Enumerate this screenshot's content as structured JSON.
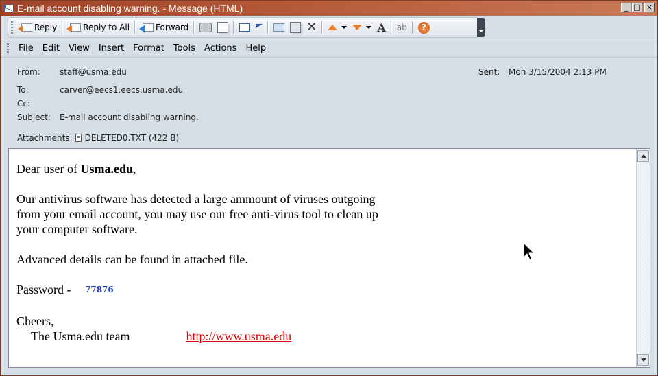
{
  "window": {
    "title": "E-mail account disabling warning. - Message (HTML)",
    "controls": {
      "minimize": "_",
      "maximize": "□",
      "close": "×"
    }
  },
  "toolbar": {
    "reply_label": "Reply",
    "reply_all_label": "Reply to All",
    "forward_label": "Forward",
    "icons": [
      "reply-icon",
      "reply-all-icon",
      "forward-icon",
      "print-icon",
      "copy-icon",
      "move-to-folder-icon",
      "flag-icon",
      "file-icon",
      "delete-icon",
      "previous-item-icon",
      "next-item-icon",
      "font-size-icon",
      "translate-icon",
      "help-icon"
    ]
  },
  "menu": {
    "items": [
      "File",
      "Edit",
      "View",
      "Insert",
      "Format",
      "Tools",
      "Actions",
      "Help"
    ]
  },
  "headers": {
    "from_label": "From:",
    "from_value": "staff@usma.edu",
    "sent_label": "Sent:",
    "sent_value": "Mon 3/15/2004 2:13 PM",
    "to_label": "To:",
    "to_value": "carver@eecs1.eecs.usma.edu",
    "cc_label": "Cc:",
    "cc_value": "",
    "subject_label": "Subject:",
    "subject_value": "E-mail account disabling warning.",
    "attachments_label": "Attachments:",
    "attachment_name": "DELETED0.TXT (422 B)"
  },
  "message": {
    "greeting_prefix": "Dear user of ",
    "greeting_domain": "Usma.edu",
    "greeting_suffix": ",",
    "para1_line1": "Our antivirus software has detected a large ammount of viruses outgoing",
    "para1_line2": "from your email account, you may use our free anti-virus tool to clean up",
    "para1_line3": "your computer software.",
    "para2": "Advanced details can be found in attached file.",
    "password_label": "Password - ",
    "password_value": "77876",
    "closing": "Cheers,",
    "signature": "The Usma.edu team",
    "link": "http://www.usma.edu"
  },
  "colors": {
    "titlebar": "#a0442b",
    "chrome": "#d6dfe6",
    "link": "#e00000",
    "password": "#1f3fc8"
  }
}
